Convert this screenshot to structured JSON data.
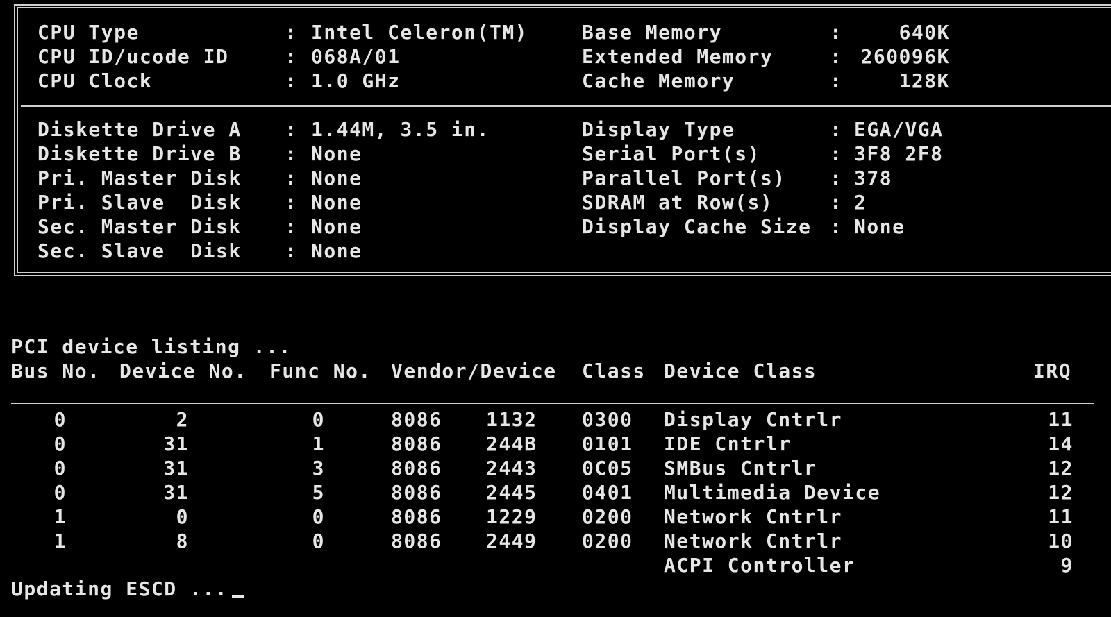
{
  "summary": {
    "cpu_type_label": "CPU Type",
    "cpu_type_value": "Intel Celeron(TM)",
    "cpu_id_label": "CPU ID/ucode ID",
    "cpu_id_value": "068A/01",
    "cpu_clock_label": "CPU Clock",
    "cpu_clock_value": "1.0 GHz",
    "base_mem_label": "Base Memory",
    "base_mem_value": "640K",
    "ext_mem_label": "Extended Memory",
    "ext_mem_value": "260096K",
    "cache_mem_label": "Cache Memory",
    "cache_mem_value": "128K",
    "left_rows": [
      {
        "label": "Diskette Drive A",
        "value": "1.44M, 3.5 in."
      },
      {
        "label": "Diskette Drive B",
        "value": "None"
      },
      {
        "label": "Pri. Master Disk",
        "value": "None"
      },
      {
        "label": "Pri. Slave  Disk",
        "value": "None"
      },
      {
        "label": "Sec. Master Disk",
        "value": "None"
      },
      {
        "label": "Sec. Slave  Disk",
        "value": "None"
      }
    ],
    "right_rows": [
      {
        "label": "Display Type",
        "value": "EGA/VGA"
      },
      {
        "label": "Serial Port(s)",
        "value": "3F8 2F8"
      },
      {
        "label": "Parallel Port(s)",
        "value": "378"
      },
      {
        "label": "SDRAM at Row(s)",
        "value": "2"
      },
      {
        "label": "Display Cache Size",
        "value": "None"
      }
    ],
    "separator": ":"
  },
  "pci": {
    "heading": "PCI device listing ...",
    "headers": {
      "bus": "Bus No.",
      "device": "Device No.",
      "func": "Func No.",
      "vendor_device": "Vendor/Device",
      "class": "Class",
      "device_class": "Device Class",
      "irq": "IRQ"
    },
    "rows": [
      {
        "bus": "0",
        "device": "2",
        "func": "0",
        "vendor": "8086",
        "dev": "1132",
        "class": "0300",
        "device_class": "Display Cntrlr",
        "irq": "11"
      },
      {
        "bus": "0",
        "device": "31",
        "func": "1",
        "vendor": "8086",
        "dev": "244B",
        "class": "0101",
        "device_class": "IDE Cntrlr",
        "irq": "14"
      },
      {
        "bus": "0",
        "device": "31",
        "func": "3",
        "vendor": "8086",
        "dev": "2443",
        "class": "0C05",
        "device_class": "SMBus Cntrlr",
        "irq": "12"
      },
      {
        "bus": "0",
        "device": "31",
        "func": "5",
        "vendor": "8086",
        "dev": "2445",
        "class": "0401",
        "device_class": "Multimedia Device",
        "irq": "12"
      },
      {
        "bus": "1",
        "device": "0",
        "func": "0",
        "vendor": "8086",
        "dev": "1229",
        "class": "0200",
        "device_class": "Network Cntrlr",
        "irq": "11"
      },
      {
        "bus": "1",
        "device": "8",
        "func": "0",
        "vendor": "8086",
        "dev": "2449",
        "class": "0200",
        "device_class": "Network Cntrlr",
        "irq": "10"
      },
      {
        "bus": "",
        "device": "",
        "func": "",
        "vendor": "",
        "dev": "",
        "class": "",
        "device_class": "ACPI Controller",
        "irq": "9"
      }
    ]
  },
  "status": {
    "message": "Updating ESCD ..."
  }
}
